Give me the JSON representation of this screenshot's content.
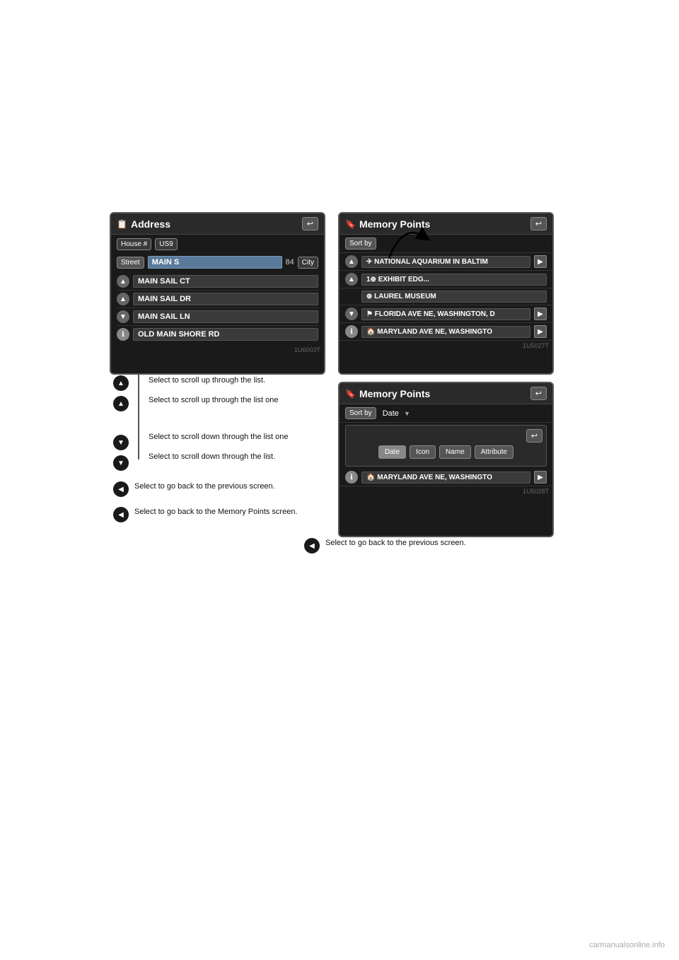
{
  "page": {
    "background": "#ffffff"
  },
  "address_screen": {
    "title": "Address",
    "title_icon": "📋",
    "back_label": "↩",
    "house_btn": "House #",
    "state_btn": "US9",
    "street_label": "Street",
    "street_value": "MAIN S",
    "street_number": "84",
    "city_btn": "City",
    "results": [
      {
        "icon": "▲",
        "name": "MAIN SAIL CT"
      },
      {
        "icon": "▲",
        "name": "MAIN SAIL DR"
      },
      {
        "icon": "▼",
        "name": "MAIN SAIL LN"
      },
      {
        "icon": "ℹ",
        "name": "OLD MAIN SHORE RD"
      }
    ],
    "code": "1U6003T"
  },
  "memory_screen_1": {
    "title": "Memory Points",
    "title_icon": "🔖",
    "back_label": "↩",
    "sort_by_label": "Sort by",
    "results": [
      {
        "icon": "▲",
        "prefix_icon": "✈",
        "name": "NATIONAL AQUARIUM IN BALTIM",
        "has_arrow": true
      },
      {
        "icon": "▲",
        "prefix_icon": "1⊕",
        "name": "EXHIBIT EDG...",
        "has_arrow": false
      },
      {
        "icon": "",
        "prefix_icon": "⊕",
        "name": "LAUREL MUSEUM",
        "has_arrow": false
      },
      {
        "icon": "▼",
        "prefix_icon": "/#",
        "name": "FLORIDA AVE NE, WASHINGTON, D",
        "has_arrow": true
      },
      {
        "icon": "ℹ",
        "prefix_icon": "🏠",
        "name": "MARYLAND AVE NE, WASHINGTO",
        "has_arrow": true
      }
    ],
    "code": "1U5027T"
  },
  "memory_screen_2": {
    "title": "Memory Points",
    "title_icon": "🔖",
    "back_label": "↩",
    "sort_by_label": "Sort by",
    "sort_by_value": "Date",
    "back_inner_label": "↩",
    "sort_options": [
      "Date",
      "Icon",
      "Name",
      "Attribute"
    ],
    "active_sort": "Date",
    "bottom_result": {
      "icon": "ℹ",
      "prefix_icon": "🏠",
      "name": "MARYLAND AVE NE, WASHINGTO",
      "has_arrow": true
    },
    "code": "1U5028T"
  },
  "annotations": {
    "left_bullets": [
      {
        "icon": "▲",
        "lines": [
          "Select to scroll up through the list."
        ]
      },
      {
        "icon": "▲",
        "lines": [
          "Select to scroll up through the list one"
        ]
      },
      {
        "icon": "▼",
        "lines": [
          "Select to scroll down through the list one"
        ]
      },
      {
        "icon": "▼",
        "lines": [
          "Select to scroll down through the list."
        ]
      }
    ],
    "bottom_left_bullets": [
      {
        "icon": "◀",
        "lines": [
          "Select to go back to the previous screen."
        ]
      },
      {
        "icon": "◀",
        "lines": [
          "Select to go back to the Memory Points screen."
        ]
      }
    ],
    "bottom_right_bullet": {
      "icon": "◀",
      "lines": [
        "Select to go back to the previous screen."
      ]
    }
  }
}
